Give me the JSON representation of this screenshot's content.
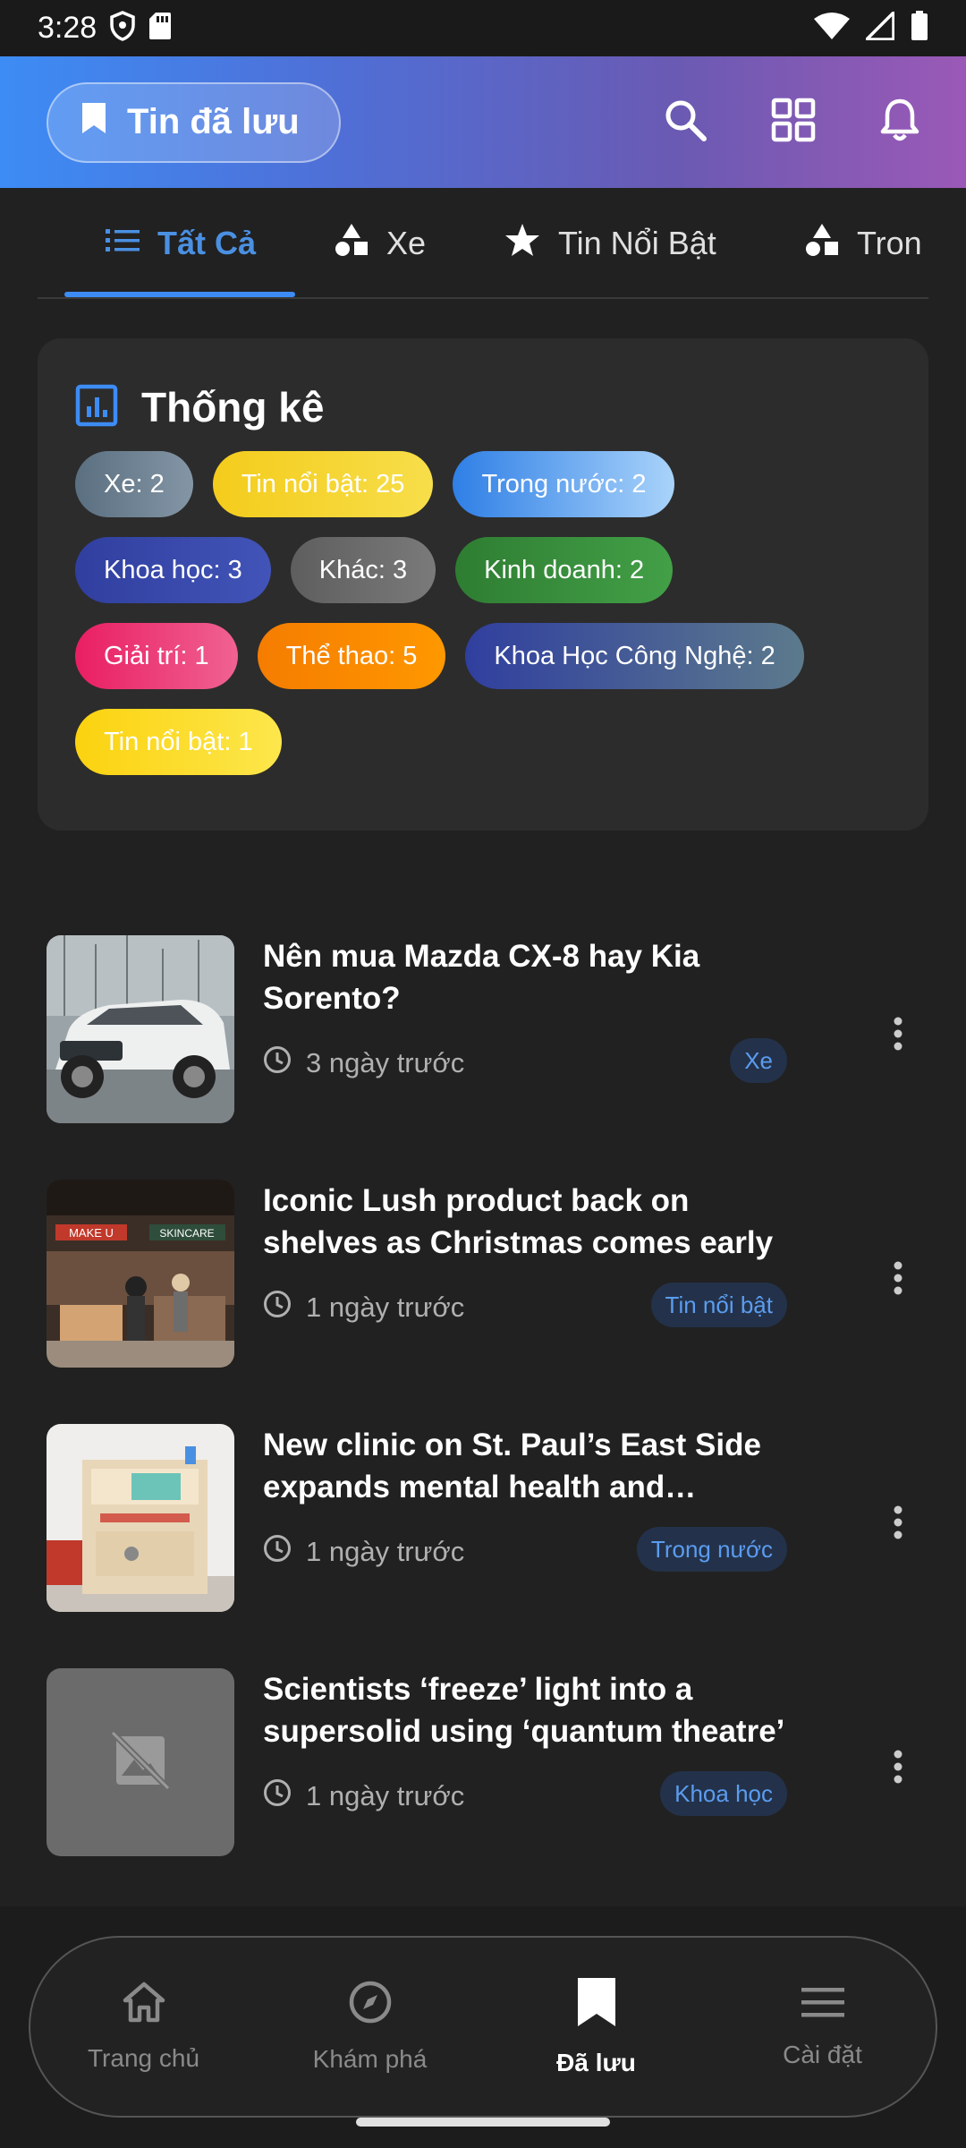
{
  "status_bar": {
    "time": "3:28"
  },
  "app_bar": {
    "title": "Tin đã lưu"
  },
  "tabs": [
    {
      "label": "Tất Cả",
      "icon": "list-icon",
      "active": true
    },
    {
      "label": "Xe",
      "icon": "category-icon",
      "active": false
    },
    {
      "label": "Tin Nổi Bật",
      "icon": "star-icon",
      "active": false
    },
    {
      "label": "Tron",
      "icon": "category-icon",
      "active": false
    }
  ],
  "stats": {
    "title": "Thống kê",
    "chips": [
      {
        "label": "Xe: 2",
        "color": "#6a7f8f"
      },
      {
        "label": "Tin nổi bật: 25",
        "color": "#f4cc1c"
      },
      {
        "label": "Trong nước: 2",
        "color": "#3d8cf5"
      },
      {
        "label": "Khoa học: 3",
        "color": "#3949ab"
      },
      {
        "label": "Khác: 3",
        "color": "#6b6b6b"
      },
      {
        "label": "Kinh doanh: 2",
        "color": "#2e7d32"
      },
      {
        "label": "Giải trí: 1",
        "color": "#e91e63"
      },
      {
        "label": "Thể thao: 5",
        "color": "#fb8c00"
      },
      {
        "label": "Khoa Học Công Nghệ: 2",
        "color": "#3f51b5"
      },
      {
        "label": "Tin nổi bật: 1",
        "color": "#fdd835"
      }
    ]
  },
  "news": [
    {
      "title": "Nên mua Mazda CX-8 hay Kia Sorento?",
      "time": "3 ngày trước",
      "category": "Xe"
    },
    {
      "title": "Iconic Lush product back on shelves as Christmas comes early",
      "time": "1 ngày trước",
      "category": "Tin nổi bật"
    },
    {
      "title": "New clinic on St. Paul’s East Side expands mental health and substance use services",
      "time": "1 ngày trước",
      "category": "Trong nước"
    },
    {
      "title": "Scientists ‘freeze’ light into a supersolid using ‘quantum theatre’",
      "time": "1 ngày trước",
      "category": "Khoa học"
    }
  ],
  "thumb_text": {
    "store_sign_1": "MAKE U",
    "store_sign_2": "SKINCARE"
  },
  "bottom_nav": [
    {
      "label": "Trang chủ",
      "icon": "home-icon",
      "active": false
    },
    {
      "label": "Khám phá",
      "icon": "compass-icon",
      "active": false
    },
    {
      "label": "Đã lưu",
      "icon": "bookmark-icon",
      "active": true
    },
    {
      "label": "Cài đặt",
      "icon": "menu-icon",
      "active": false
    }
  ],
  "colors": {
    "accent": "#3d8cf5",
    "background": "#212121",
    "card": "#2c2c2c"
  }
}
